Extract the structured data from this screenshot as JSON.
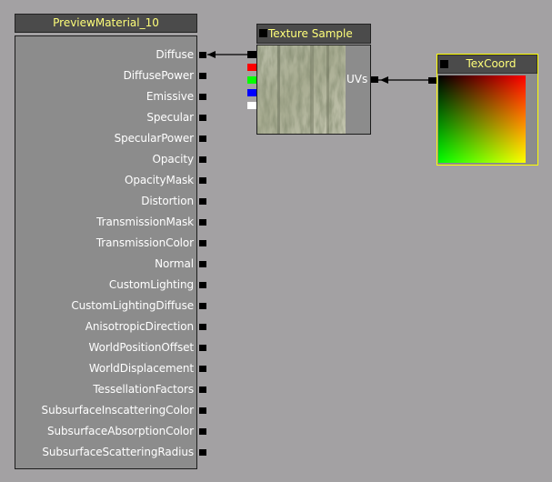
{
  "material_node": {
    "title": "PreviewMaterial_10",
    "inputs": [
      "Diffuse",
      "DiffusePower",
      "Emissive",
      "Specular",
      "SpecularPower",
      "Opacity",
      "OpacityMask",
      "Distortion",
      "TransmissionMask",
      "TransmissionColor",
      "Normal",
      "CustomLighting",
      "CustomLightingDiffuse",
      "AnisotropicDirection",
      "WorldPositionOffset",
      "WorldDisplacement",
      "TessellationFactors",
      "SubsurfaceInscatteringColor",
      "SubsurfaceAbsorptionColor",
      "SubsurfaceScatteringRadius"
    ]
  },
  "texture_node": {
    "title": "Texture Sample",
    "uv_label": "UVs",
    "channel_colors": [
      "#ff0000",
      "#00ff00",
      "#0000ff",
      "#ffffff"
    ]
  },
  "texcoord_node": {
    "title": "TexCoord"
  },
  "colors": {
    "background": "#a3a1a3",
    "title_text": "#ffff7a",
    "selection_outline": "#ffff00"
  }
}
